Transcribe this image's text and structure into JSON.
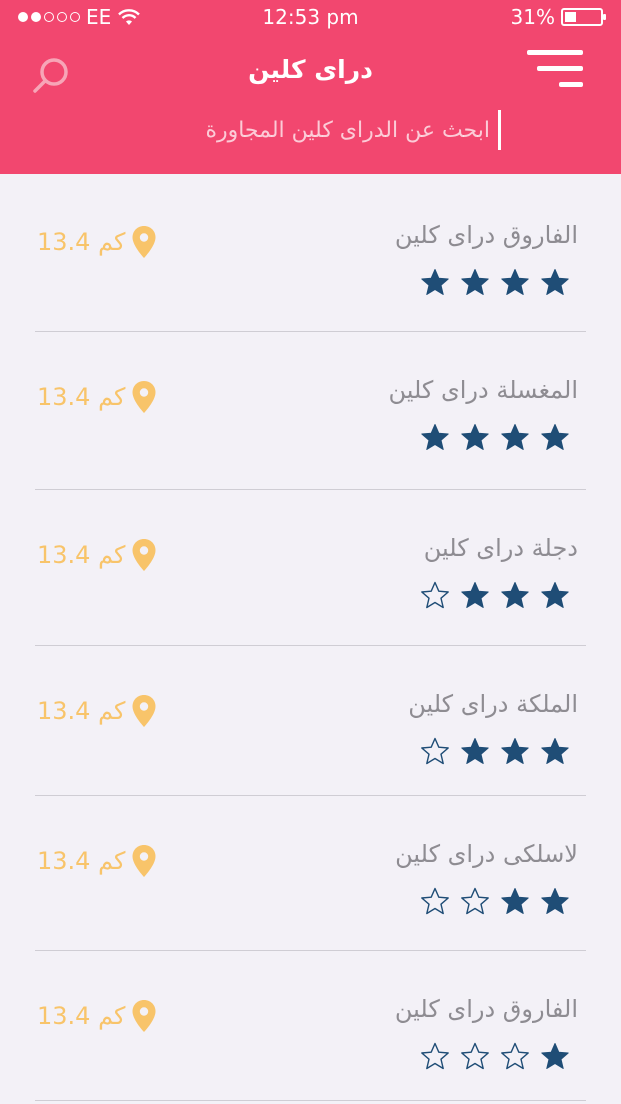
{
  "status_bar": {
    "carrier": "EE",
    "time": "12:53 pm",
    "battery_percent": "31%",
    "battery_level": 0.31,
    "signal_bars_filled": 2,
    "signal_bars_total": 5
  },
  "header": {
    "title": "دراى كلين",
    "search_placeholder": "ابحث عن الدراى كلين المجاورة",
    "menu_icon": "menu-icon",
    "search_icon": "search-icon"
  },
  "colors": {
    "header_bg": "#f2476f",
    "star_filled": "#1f4d76",
    "distance": "#f8c46a",
    "name_text": "#8e8c92",
    "background": "#f3f1f7"
  },
  "places": [
    {
      "name": "الفاروق دراى كلين",
      "rating": 4,
      "max_rating": 4,
      "distance": "13.4 كم"
    },
    {
      "name": "المغسلة دراى كلين",
      "rating": 4,
      "max_rating": 4,
      "distance": "13.4 كم"
    },
    {
      "name": "دجلة دراى كلين",
      "rating": 3,
      "max_rating": 4,
      "distance": "13.4 كم"
    },
    {
      "name": "الملكة دراى كلين",
      "rating": 3,
      "max_rating": 4,
      "distance": "13.4 كم"
    },
    {
      "name": "لاسلكى دراى كلين",
      "rating": 2,
      "max_rating": 4,
      "distance": "13.4 كم"
    },
    {
      "name": "الفاروق دراى كلين",
      "rating": 1,
      "max_rating": 4,
      "distance": "13.4 كم"
    }
  ]
}
